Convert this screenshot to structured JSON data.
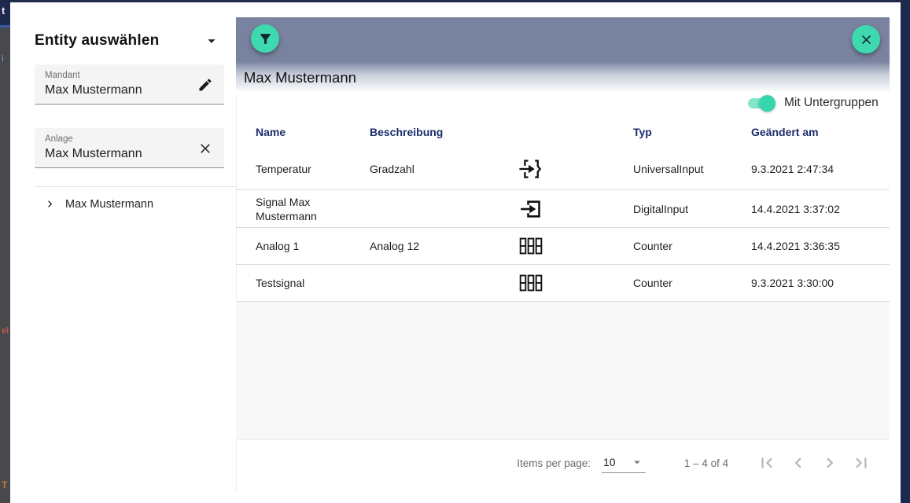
{
  "backdrop": {
    "fragments": [
      "t",
      "i",
      "el",
      "T"
    ]
  },
  "sidebar": {
    "title": "Entity auswählen",
    "collapse_icon": "caret-down",
    "fields": [
      {
        "label": "Mandant",
        "value": "Max Mustermann",
        "icon": "pencil"
      },
      {
        "label": "Anlage",
        "value": "Max Mustermann",
        "icon": "close"
      }
    ],
    "tree": [
      {
        "label": "Max Mustermann",
        "icon": "chevron-right"
      }
    ]
  },
  "main": {
    "title": "Max Mustermann",
    "filter_icon": "funnel",
    "close_icon": "close",
    "toggle": {
      "label": "Mit Untergruppen",
      "state": "on"
    },
    "table": {
      "columns": [
        "Name",
        "Beschreibung",
        "",
        "Typ",
        "Geändert am"
      ],
      "rows": [
        {
          "name": "Temperatur",
          "beschreibung": "Gradzahl",
          "icon": "braces-arrow-icon",
          "typ": "UniversalInput",
          "geaendert": "9.3.2021 2:47:34"
        },
        {
          "name": "Signal Max Mustermann",
          "beschreibung": "",
          "icon": "login-arrow-icon",
          "typ": "DigitalInput",
          "geaendert": "14.4.2021 3:37:02"
        },
        {
          "name": "Analog 1",
          "beschreibung": "Analog 12",
          "icon": "seven-segment-icon",
          "typ": "Counter",
          "geaendert": "14.4.2021 3:36:35"
        },
        {
          "name": "Testsignal",
          "beschreibung": "",
          "icon": "seven-segment-icon",
          "typ": "Counter",
          "geaendert": "9.3.2021 3:30:00"
        }
      ]
    },
    "paginator": {
      "items_per_page_label": "Items per page:",
      "page_size": "10",
      "range_label": "1 – 4 of 4"
    }
  },
  "colors": {
    "accent_teal": "#3ed9af",
    "header_bar": "#79839f",
    "table_header_text": "#1c2d6b",
    "backdrop_navy": "#1d2a4e"
  }
}
